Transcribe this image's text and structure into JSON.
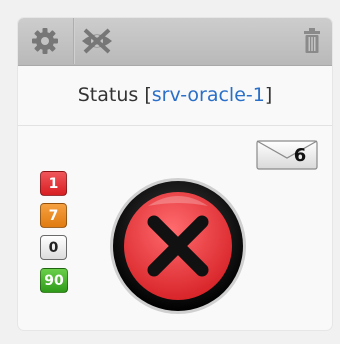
{
  "toolbar": {
    "icons": [
      "gear-icon",
      "hidden-eye-icon",
      "trash-icon"
    ]
  },
  "status": {
    "label": "Status",
    "bracket_open": "[",
    "host": "srv-oracle-1",
    "bracket_close": "]"
  },
  "badges": [
    {
      "value": "1",
      "color": "#e3262a"
    },
    {
      "value": "7",
      "color": "#ea8a1e"
    },
    {
      "value": "0",
      "color": "#ffffff"
    },
    {
      "value": "90",
      "color": "#3fb02a"
    }
  ],
  "status_icon": "error-x-icon",
  "messages": {
    "count": "6"
  },
  "colors": {
    "host_link": "#2a6fc8",
    "error": "#e8383c"
  }
}
